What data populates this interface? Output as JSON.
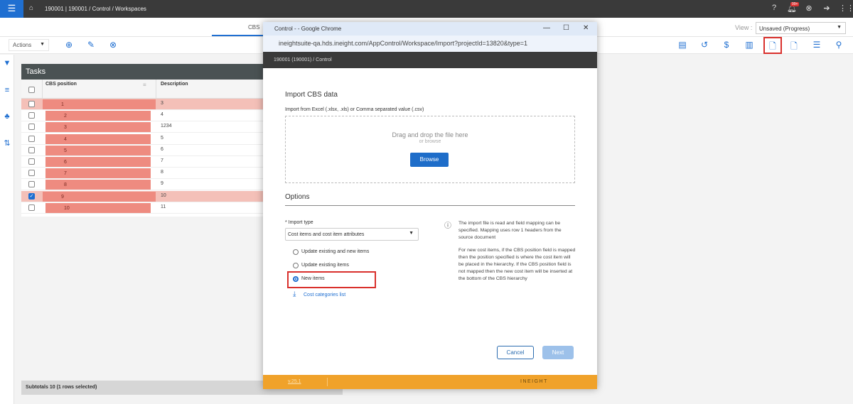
{
  "topbar": {
    "breadcrumb": "190001 | 190001  /  Control  /  Workspaces",
    "notification_count": "99+"
  },
  "tabs": {
    "active": "CBS"
  },
  "view": {
    "label": "View :",
    "selected": "Unsaved (Progress)"
  },
  "toolbar": {
    "actions_label": "Actions"
  },
  "grid": {
    "title": "Tasks",
    "columns": [
      "CBS position",
      "Description"
    ],
    "rows": [
      {
        "pos": "1",
        "desc": "3",
        "checked": false,
        "highlight": true
      },
      {
        "pos": "2",
        "desc": "4",
        "checked": false,
        "highlight": false
      },
      {
        "pos": "3",
        "desc": "1234",
        "checked": false,
        "highlight": false
      },
      {
        "pos": "4",
        "desc": "5",
        "checked": false,
        "highlight": false
      },
      {
        "pos": "5",
        "desc": "6",
        "checked": false,
        "highlight": false
      },
      {
        "pos": "6",
        "desc": "7",
        "checked": false,
        "highlight": false
      },
      {
        "pos": "7",
        "desc": "8",
        "checked": false,
        "highlight": false
      },
      {
        "pos": "8",
        "desc": "9",
        "checked": false,
        "highlight": false
      },
      {
        "pos": "9",
        "desc": "10",
        "checked": true,
        "highlight": true
      },
      {
        "pos": "10",
        "desc": "11",
        "checked": false,
        "highlight": false
      }
    ],
    "subtotals": "Subtotals 10 (1 rows selected)"
  },
  "modal": {
    "window_title": "Control - - Google Chrome",
    "url": "ineightsuite-qa.hds.ineight.com/AppControl/Workspace/Import?projectId=13820&type=1",
    "breadcrumb": "190001 (190001)  /  Control",
    "heading": "Import CBS data",
    "subheading": "Import from Excel (.xlsx, .xls) or Comma separated value (.csv)",
    "drop_text": "Drag and drop the file here",
    "or_browse": "or browse",
    "browse_label": "Browse",
    "options_heading": "Options",
    "import_type_label": "* Import type",
    "import_type_value": "Cost items and cost item attributes",
    "radio_options": [
      {
        "label": "Update existing and new items",
        "selected": false
      },
      {
        "label": "Update existing items",
        "selected": false
      },
      {
        "label": "New items",
        "selected": true
      }
    ],
    "cost_categories_link": "Cost categories list",
    "info_p1": "The import file is read and field mapping can be specified. Mapping uses row 1 headers from the source document",
    "info_p2": "For new cost items, if the CBS position field is mapped then the position specified is where the cost item will be placed in the hierarchy. If the CBS position field is not mapped then the new cost item will be inserted at the bottom of the CBS hierarchy",
    "cancel_label": "Cancel",
    "next_label": "Next",
    "version": "v.25.1",
    "brand": "INEIGHT"
  }
}
